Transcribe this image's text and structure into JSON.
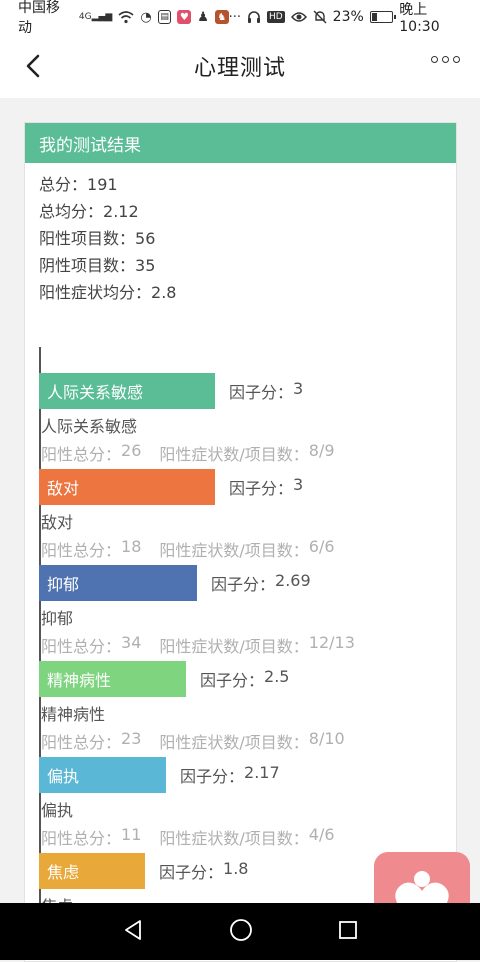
{
  "status_bar": {
    "carrier": "中国移动",
    "network": "4G",
    "battery_percent": "23%",
    "time": "晚上10:30",
    "icons": [
      "signal-icon",
      "wifi-icon",
      "app-icon",
      "clipboard-icon",
      "shield-app-icon",
      "penguin-icon",
      "game-app-icon",
      "more-dots-icon",
      "headset-icon",
      "hd-icon",
      "eye-icon",
      "mute-icon",
      "battery-icon"
    ]
  },
  "nav": {
    "title": "心理测试",
    "back_icon": "chevron-left-icon",
    "more_icon": "more-icon"
  },
  "card": {
    "header": "我的测试结果",
    "summary": [
      {
        "label": "总分：",
        "value": "191"
      },
      {
        "label": "总均分：",
        "value": "2.12"
      },
      {
        "label": "阳性项目数：",
        "value": "56"
      },
      {
        "label": "阴性项目数：",
        "value": "35"
      },
      {
        "label": "阳性症状均分：",
        "value": "2.8"
      }
    ]
  },
  "factor_labels": {
    "score_label": "因子分：",
    "positive_total_label": "阳性总分：",
    "ratio_label": "阳性症状数/项目数："
  },
  "chart_data": {
    "type": "bar",
    "orientation": "horizontal",
    "categories": [
      "人际关系敏感",
      "敌对",
      "抑郁",
      "精神病性",
      "偏执",
      "焦虑"
    ],
    "values": [
      3,
      3,
      2.69,
      2.5,
      2.17,
      1.8
    ],
    "colors": [
      "#5bbd96",
      "#ec7540",
      "#4f73b0",
      "#7fd47f",
      "#5bb7d6",
      "#e8a93a"
    ],
    "positive_totals": [
      "26",
      "18",
      "34",
      "23",
      "11",
      ""
    ],
    "ratios": [
      "8/9",
      "6/6",
      "12/13",
      "8/10",
      "4/6",
      ""
    ]
  },
  "factors": [
    {
      "name": "人际关系敏感",
      "score": "3",
      "positive_total": "26",
      "ratio": "8/9"
    },
    {
      "name": "敌对",
      "score": "3",
      "positive_total": "18",
      "ratio": "6/6"
    },
    {
      "name": "抑郁",
      "score": "2.69",
      "positive_total": "34",
      "ratio": "12/13"
    },
    {
      "name": "精神病性",
      "score": "2.5",
      "positive_total": "23",
      "ratio": "8/10"
    },
    {
      "name": "偏执",
      "score": "2.17",
      "positive_total": "11",
      "ratio": "4/6"
    },
    {
      "name": "焦虑",
      "score": "1.8"
    }
  ],
  "android_nav": {
    "back": "back-triangle-icon",
    "home": "home-circle-icon",
    "recents": "recents-square-icon"
  },
  "floating_app_icon": "heart-app-icon"
}
